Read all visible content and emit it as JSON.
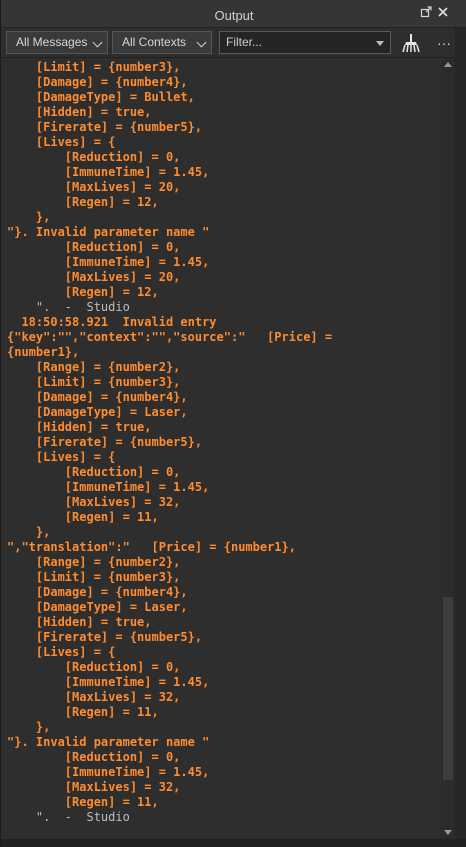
{
  "window": {
    "title": "Output",
    "undock_icon": "undock-icon",
    "close_icon": "close-icon"
  },
  "toolbar": {
    "messages_filter": "All Messages",
    "contexts_filter": "All Contexts",
    "filter_placeholder": "Filter...",
    "clear_icon": "broom-icon",
    "more_label": "···"
  },
  "output": {
    "lines": [
      {
        "text": "    [Limit] = {number3},",
        "muted": false
      },
      {
        "text": "    [Damage] = {number4},",
        "muted": false
      },
      {
        "text": "    [DamageType] = Bullet,",
        "muted": false
      },
      {
        "text": "    [Hidden] = true,",
        "muted": false
      },
      {
        "text": "    [Firerate] = {number5},",
        "muted": false
      },
      {
        "text": "    [Lives] = {",
        "muted": false
      },
      {
        "text": "        [Reduction] = 0,",
        "muted": false
      },
      {
        "text": "        [ImmuneTime] = 1.45,",
        "muted": false
      },
      {
        "text": "        [MaxLives] = 20,",
        "muted": false
      },
      {
        "text": "        [Regen] = 12,",
        "muted": false
      },
      {
        "text": "    },",
        "muted": false
      },
      {
        "text": "\"}. Invalid parameter name \"",
        "muted": false
      },
      {
        "text": "        [Reduction] = 0,",
        "muted": false
      },
      {
        "text": "        [ImmuneTime] = 1.45,",
        "muted": false
      },
      {
        "text": "        [MaxLives] = 20,",
        "muted": false
      },
      {
        "text": "        [Regen] = 12,",
        "muted": false
      },
      {
        "text": "    \".  -  Studio",
        "muted": true
      },
      {
        "text": "  18:50:58.921  Invalid entry",
        "muted": false
      },
      {
        "text": "{\"key\":\"\",\"context\":\"\",\"source\":\"   [Price] =",
        "muted": false
      },
      {
        "text": "{number1},",
        "muted": false
      },
      {
        "text": "    [Range] = {number2},",
        "muted": false
      },
      {
        "text": "    [Limit] = {number3},",
        "muted": false
      },
      {
        "text": "    [Damage] = {number4},",
        "muted": false
      },
      {
        "text": "    [DamageType] = Laser,",
        "muted": false
      },
      {
        "text": "    [Hidden] = true,",
        "muted": false
      },
      {
        "text": "    [Firerate] = {number5},",
        "muted": false
      },
      {
        "text": "    [Lives] = {",
        "muted": false
      },
      {
        "text": "        [Reduction] = 0,",
        "muted": false
      },
      {
        "text": "        [ImmuneTime] = 1.45,",
        "muted": false
      },
      {
        "text": "        [MaxLives] = 32,",
        "muted": false
      },
      {
        "text": "        [Regen] = 11,",
        "muted": false
      },
      {
        "text": "    },",
        "muted": false
      },
      {
        "text": "\",\"translation\":\"   [Price] = {number1},",
        "muted": false
      },
      {
        "text": "    [Range] = {number2},",
        "muted": false
      },
      {
        "text": "    [Limit] = {number3},",
        "muted": false
      },
      {
        "text": "    [Damage] = {number4},",
        "muted": false
      },
      {
        "text": "    [DamageType] = Laser,",
        "muted": false
      },
      {
        "text": "    [Hidden] = true,",
        "muted": false
      },
      {
        "text": "    [Firerate] = {number5},",
        "muted": false
      },
      {
        "text": "    [Lives] = {",
        "muted": false
      },
      {
        "text": "        [Reduction] = 0,",
        "muted": false
      },
      {
        "text": "        [ImmuneTime] = 1.45,",
        "muted": false
      },
      {
        "text": "        [MaxLives] = 32,",
        "muted": false
      },
      {
        "text": "        [Regen] = 11,",
        "muted": false
      },
      {
        "text": "    },",
        "muted": false
      },
      {
        "text": "\"}. Invalid parameter name \"",
        "muted": false
      },
      {
        "text": "        [Reduction] = 0,",
        "muted": false
      },
      {
        "text": "        [ImmuneTime] = 1.45,",
        "muted": false
      },
      {
        "text": "        [MaxLives] = 32,",
        "muted": false
      },
      {
        "text": "        [Regen] = 11,",
        "muted": false
      },
      {
        "text": "    \".  -  Studio",
        "muted": true
      }
    ]
  },
  "scrollbar": {
    "scroll_position": 0.92,
    "thumb_fraction": 0.07
  },
  "colors": {
    "error_text": "#ff8c2e",
    "info_text": "#bdbdbd",
    "background": "#2e2e2e"
  }
}
